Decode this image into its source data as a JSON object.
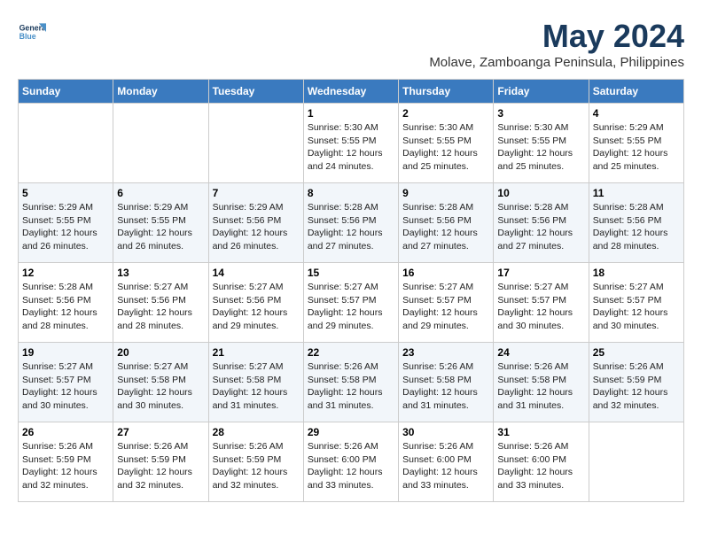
{
  "logo": {
    "line1": "General",
    "line2": "Blue"
  },
  "title": "May 2024",
  "location": "Molave, Zamboanga Peninsula, Philippines",
  "days_of_week": [
    "Sunday",
    "Monday",
    "Tuesday",
    "Wednesday",
    "Thursday",
    "Friday",
    "Saturday"
  ],
  "weeks": [
    [
      {
        "day": "",
        "info": ""
      },
      {
        "day": "",
        "info": ""
      },
      {
        "day": "",
        "info": ""
      },
      {
        "day": "1",
        "info": "Sunrise: 5:30 AM\nSunset: 5:55 PM\nDaylight: 12 hours\nand 24 minutes."
      },
      {
        "day": "2",
        "info": "Sunrise: 5:30 AM\nSunset: 5:55 PM\nDaylight: 12 hours\nand 25 minutes."
      },
      {
        "day": "3",
        "info": "Sunrise: 5:30 AM\nSunset: 5:55 PM\nDaylight: 12 hours\nand 25 minutes."
      },
      {
        "day": "4",
        "info": "Sunrise: 5:29 AM\nSunset: 5:55 PM\nDaylight: 12 hours\nand 25 minutes."
      }
    ],
    [
      {
        "day": "5",
        "info": "Sunrise: 5:29 AM\nSunset: 5:55 PM\nDaylight: 12 hours\nand 26 minutes."
      },
      {
        "day": "6",
        "info": "Sunrise: 5:29 AM\nSunset: 5:55 PM\nDaylight: 12 hours\nand 26 minutes."
      },
      {
        "day": "7",
        "info": "Sunrise: 5:29 AM\nSunset: 5:56 PM\nDaylight: 12 hours\nand 26 minutes."
      },
      {
        "day": "8",
        "info": "Sunrise: 5:28 AM\nSunset: 5:56 PM\nDaylight: 12 hours\nand 27 minutes."
      },
      {
        "day": "9",
        "info": "Sunrise: 5:28 AM\nSunset: 5:56 PM\nDaylight: 12 hours\nand 27 minutes."
      },
      {
        "day": "10",
        "info": "Sunrise: 5:28 AM\nSunset: 5:56 PM\nDaylight: 12 hours\nand 27 minutes."
      },
      {
        "day": "11",
        "info": "Sunrise: 5:28 AM\nSunset: 5:56 PM\nDaylight: 12 hours\nand 28 minutes."
      }
    ],
    [
      {
        "day": "12",
        "info": "Sunrise: 5:28 AM\nSunset: 5:56 PM\nDaylight: 12 hours\nand 28 minutes."
      },
      {
        "day": "13",
        "info": "Sunrise: 5:27 AM\nSunset: 5:56 PM\nDaylight: 12 hours\nand 28 minutes."
      },
      {
        "day": "14",
        "info": "Sunrise: 5:27 AM\nSunset: 5:56 PM\nDaylight: 12 hours\nand 29 minutes."
      },
      {
        "day": "15",
        "info": "Sunrise: 5:27 AM\nSunset: 5:57 PM\nDaylight: 12 hours\nand 29 minutes."
      },
      {
        "day": "16",
        "info": "Sunrise: 5:27 AM\nSunset: 5:57 PM\nDaylight: 12 hours\nand 29 minutes."
      },
      {
        "day": "17",
        "info": "Sunrise: 5:27 AM\nSunset: 5:57 PM\nDaylight: 12 hours\nand 30 minutes."
      },
      {
        "day": "18",
        "info": "Sunrise: 5:27 AM\nSunset: 5:57 PM\nDaylight: 12 hours\nand 30 minutes."
      }
    ],
    [
      {
        "day": "19",
        "info": "Sunrise: 5:27 AM\nSunset: 5:57 PM\nDaylight: 12 hours\nand 30 minutes."
      },
      {
        "day": "20",
        "info": "Sunrise: 5:27 AM\nSunset: 5:58 PM\nDaylight: 12 hours\nand 30 minutes."
      },
      {
        "day": "21",
        "info": "Sunrise: 5:27 AM\nSunset: 5:58 PM\nDaylight: 12 hours\nand 31 minutes."
      },
      {
        "day": "22",
        "info": "Sunrise: 5:26 AM\nSunset: 5:58 PM\nDaylight: 12 hours\nand 31 minutes."
      },
      {
        "day": "23",
        "info": "Sunrise: 5:26 AM\nSunset: 5:58 PM\nDaylight: 12 hours\nand 31 minutes."
      },
      {
        "day": "24",
        "info": "Sunrise: 5:26 AM\nSunset: 5:58 PM\nDaylight: 12 hours\nand 31 minutes."
      },
      {
        "day": "25",
        "info": "Sunrise: 5:26 AM\nSunset: 5:59 PM\nDaylight: 12 hours\nand 32 minutes."
      }
    ],
    [
      {
        "day": "26",
        "info": "Sunrise: 5:26 AM\nSunset: 5:59 PM\nDaylight: 12 hours\nand 32 minutes."
      },
      {
        "day": "27",
        "info": "Sunrise: 5:26 AM\nSunset: 5:59 PM\nDaylight: 12 hours\nand 32 minutes."
      },
      {
        "day": "28",
        "info": "Sunrise: 5:26 AM\nSunset: 5:59 PM\nDaylight: 12 hours\nand 32 minutes."
      },
      {
        "day": "29",
        "info": "Sunrise: 5:26 AM\nSunset: 6:00 PM\nDaylight: 12 hours\nand 33 minutes."
      },
      {
        "day": "30",
        "info": "Sunrise: 5:26 AM\nSunset: 6:00 PM\nDaylight: 12 hours\nand 33 minutes."
      },
      {
        "day": "31",
        "info": "Sunrise: 5:26 AM\nSunset: 6:00 PM\nDaylight: 12 hours\nand 33 minutes."
      },
      {
        "day": "",
        "info": ""
      }
    ]
  ]
}
